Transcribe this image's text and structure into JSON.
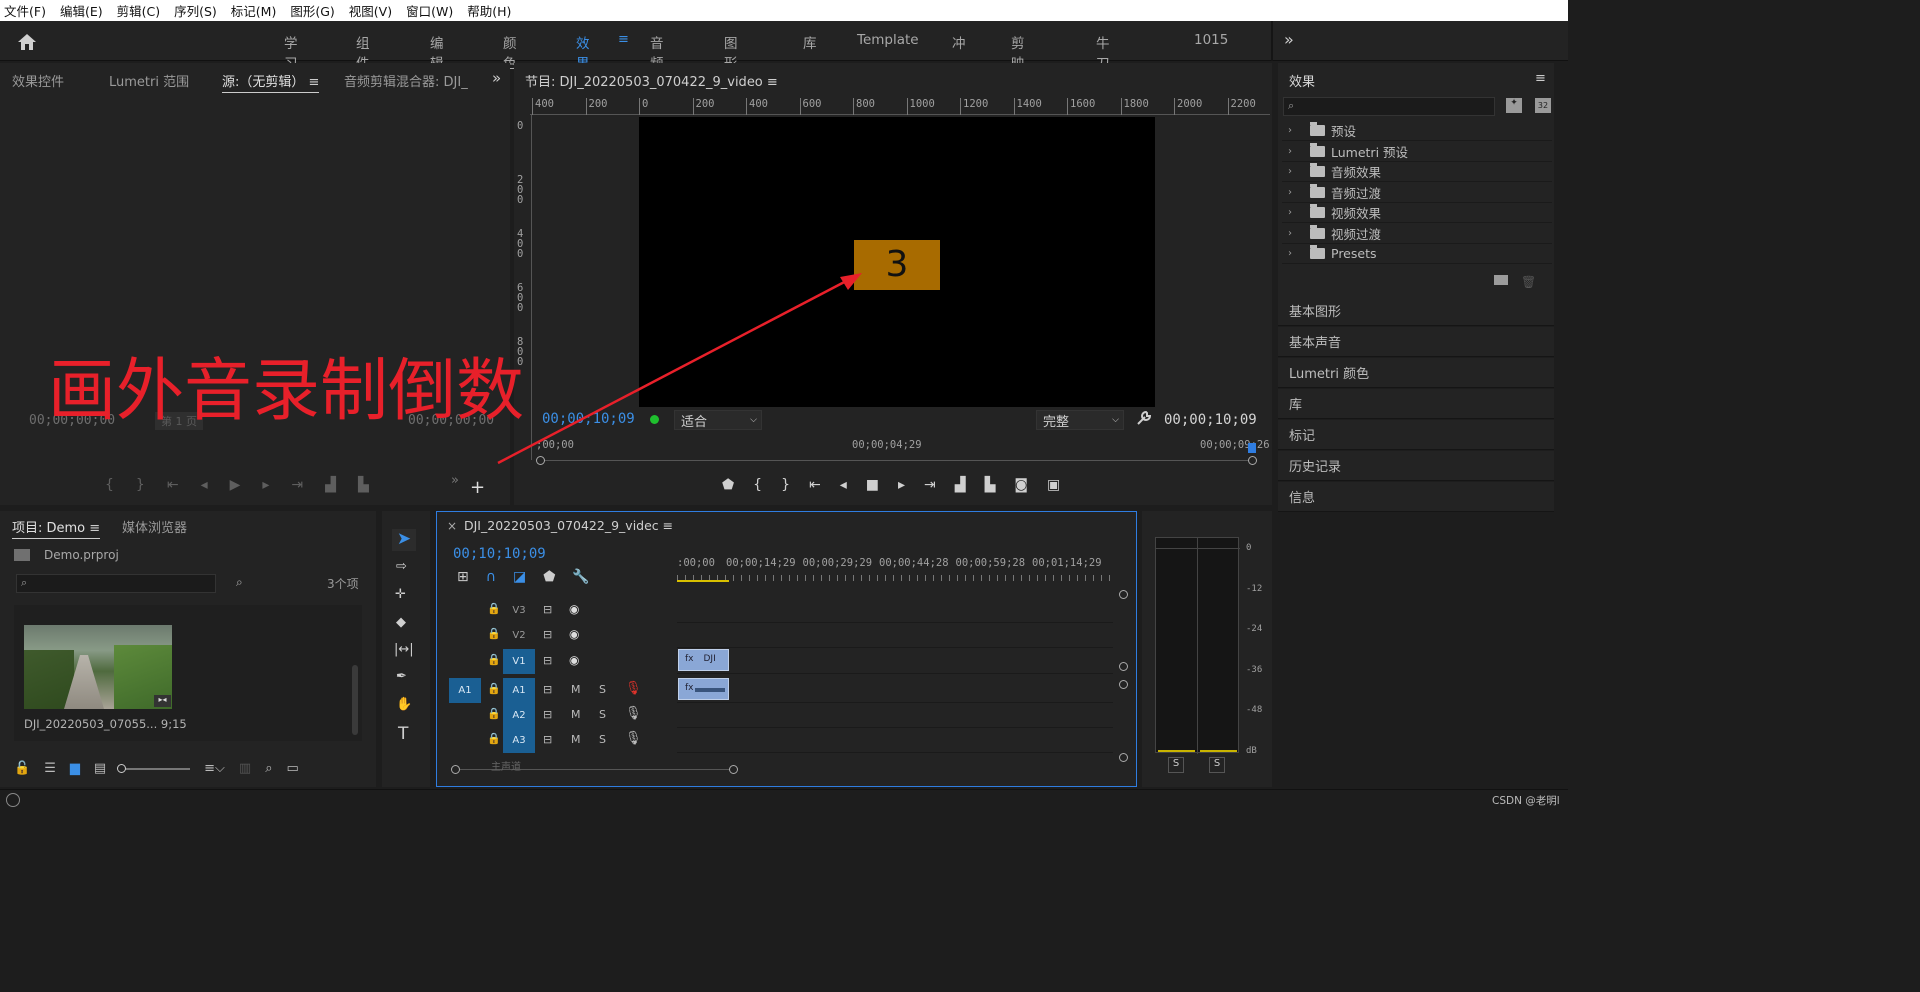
{
  "menu": [
    "文件(F)",
    "编辑(E)",
    "剪辑(C)",
    "序列(S)",
    "标记(M)",
    "图形(G)",
    "视图(V)",
    "窗口(W)",
    "帮助(H)"
  ],
  "workspaces": [
    {
      "label": "学习",
      "active": false
    },
    {
      "label": "组件",
      "active": false
    },
    {
      "label": "编辑",
      "active": false
    },
    {
      "label": "颜色",
      "active": false
    },
    {
      "label": "效果",
      "active": true
    },
    {
      "label": "音频",
      "active": false
    },
    {
      "label": "图形",
      "active": false
    },
    {
      "label": "库",
      "active": false
    },
    {
      "label": "Template",
      "active": false
    },
    {
      "label": "冲",
      "active": false
    },
    {
      "label": "剪映就",
      "active": false
    },
    {
      "label": "牛刀常用",
      "active": false
    },
    {
      "label": "1015",
      "active": false
    }
  ],
  "source_panel": {
    "tabs": [
      "效果控件",
      "Lumetri 范围",
      "源:（无剪辑）",
      "音频剪辑混合器: DJI_"
    ],
    "timecode_left": "00;00;00;00",
    "page": "第 1 页",
    "timecode_right": "00;00;00;00"
  },
  "program_panel": {
    "title": "节目: DJI_20220503_070422_9_video",
    "ruler_h": [
      "400",
      "200",
      "0",
      "200",
      "400",
      "600",
      "800",
      "1000",
      "1200",
      "1400",
      "1600",
      "1800",
      "2000",
      "2200"
    ],
    "ruler_v": [
      "0",
      "2 0 0",
      "4 0 0",
      "6 0 0",
      "8 0 0"
    ],
    "countdown": "3",
    "timecode": "00;00;10;09",
    "fit": "适合",
    "quality": "完整",
    "duration": "00;00;10;09",
    "time_ruler": [
      ";00;00",
      "00;00;04;29",
      "00;00;09;26"
    ]
  },
  "annotation": {
    "text": "画外音录制倒数",
    "color": "#e8202a"
  },
  "effects_panel": {
    "title": "效果",
    "items": [
      "预设",
      "Lumetri 预设",
      "音频效果",
      "音频过渡",
      "视频效果",
      "视频过渡",
      "Presets"
    ],
    "sections": [
      "基本图形",
      "基本声音",
      "Lumetri 颜色",
      "库",
      "标记",
      "历史记录",
      "信息"
    ]
  },
  "project_panel": {
    "tabs": [
      "项目: Demo",
      "媒体浏览器"
    ],
    "project_file": "Demo.prproj",
    "item_count": "3个项",
    "clip_name": "DJI_20220503_07055...",
    "clip_duration": "9;15"
  },
  "timeline": {
    "title": "DJI_20220503_070422_9_videc",
    "timecode": "00;10;10;09",
    "ruler": ":00;00",
    "ruler_marks": [
      "00;00;14;29",
      "00;00;29;29",
      "00;00;44;28",
      "00;00;59;28",
      "00;01;14;29"
    ],
    "video_tracks": [
      "V3",
      "V2",
      "V1"
    ],
    "audio_tracks": [
      "A1",
      "A2",
      "A3"
    ],
    "source_patch": "A1",
    "clip_label": "DJI",
    "mix_label": "主声道"
  },
  "meter": {
    "scale": [
      "0",
      "-12",
      "-24",
      "-36",
      "-48",
      "dB"
    ],
    "solo": [
      "S",
      "S"
    ]
  },
  "status": {
    "watermark": "CSDN @老明l"
  }
}
